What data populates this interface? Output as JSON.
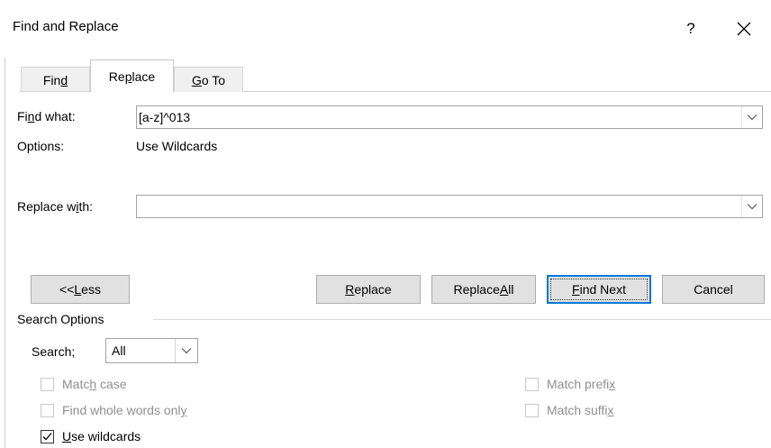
{
  "window": {
    "title": "Find and Replace",
    "help_glyph": "?",
    "help_icon": "question-mark-icon",
    "close_icon": "close-x-icon"
  },
  "tabs": [
    {
      "label_pre": "Fin",
      "label_u": "d",
      "label_post": "",
      "active": false
    },
    {
      "label_pre": "Re",
      "label_u": "p",
      "label_post": "lace",
      "active": true
    },
    {
      "label_pre": "",
      "label_u": "G",
      "label_post": "o To",
      "active": false
    }
  ],
  "find": {
    "label_pre": "Fi",
    "label_u": "n",
    "label_post": "d what:",
    "value": "[a-z]^013"
  },
  "options": {
    "label": "Options:",
    "value": "Use Wildcards"
  },
  "replace": {
    "label_pre": "Replace w",
    "label_u": "i",
    "label_post": "th:",
    "value": ""
  },
  "buttons": {
    "less": {
      "pre": "<< ",
      "u": "L",
      "post": "ess"
    },
    "replace": {
      "pre": "",
      "u": "R",
      "post": "eplace"
    },
    "replace_all": {
      "pre": "Replace ",
      "u": "A",
      "post": "ll"
    },
    "find_next": {
      "pre": "",
      "u": "F",
      "post": "ind Next"
    },
    "cancel": "Cancel"
  },
  "search_options": {
    "heading": "Search Options",
    "search_label_pre": "Search",
    "search_label_u": ";",
    "search_label_post": "",
    "search_value": "All",
    "checkboxes_left": [
      {
        "label_pre": "Matc",
        "label_u": "h",
        "label_post": " case",
        "checked": false,
        "disabled": true
      },
      {
        "label_pre": "Find whole words onl",
        "label_u": "y",
        "label_post": "",
        "checked": false,
        "disabled": true
      },
      {
        "label_pre": "",
        "label_u": "U",
        "label_post": "se wildcards",
        "checked": true,
        "disabled": false
      }
    ],
    "checkboxes_right": [
      {
        "label_pre": "Match prefi",
        "label_u": "x",
        "label_post": "",
        "checked": false,
        "disabled": true
      },
      {
        "label_pre": "Match suffi",
        "label_u": "x",
        "label_post": "",
        "checked": false,
        "disabled": true
      }
    ]
  },
  "colors": {
    "accent": "#0078d7",
    "button_bg": "#e1e1e1",
    "disabled_text": "#8f8f8f"
  }
}
